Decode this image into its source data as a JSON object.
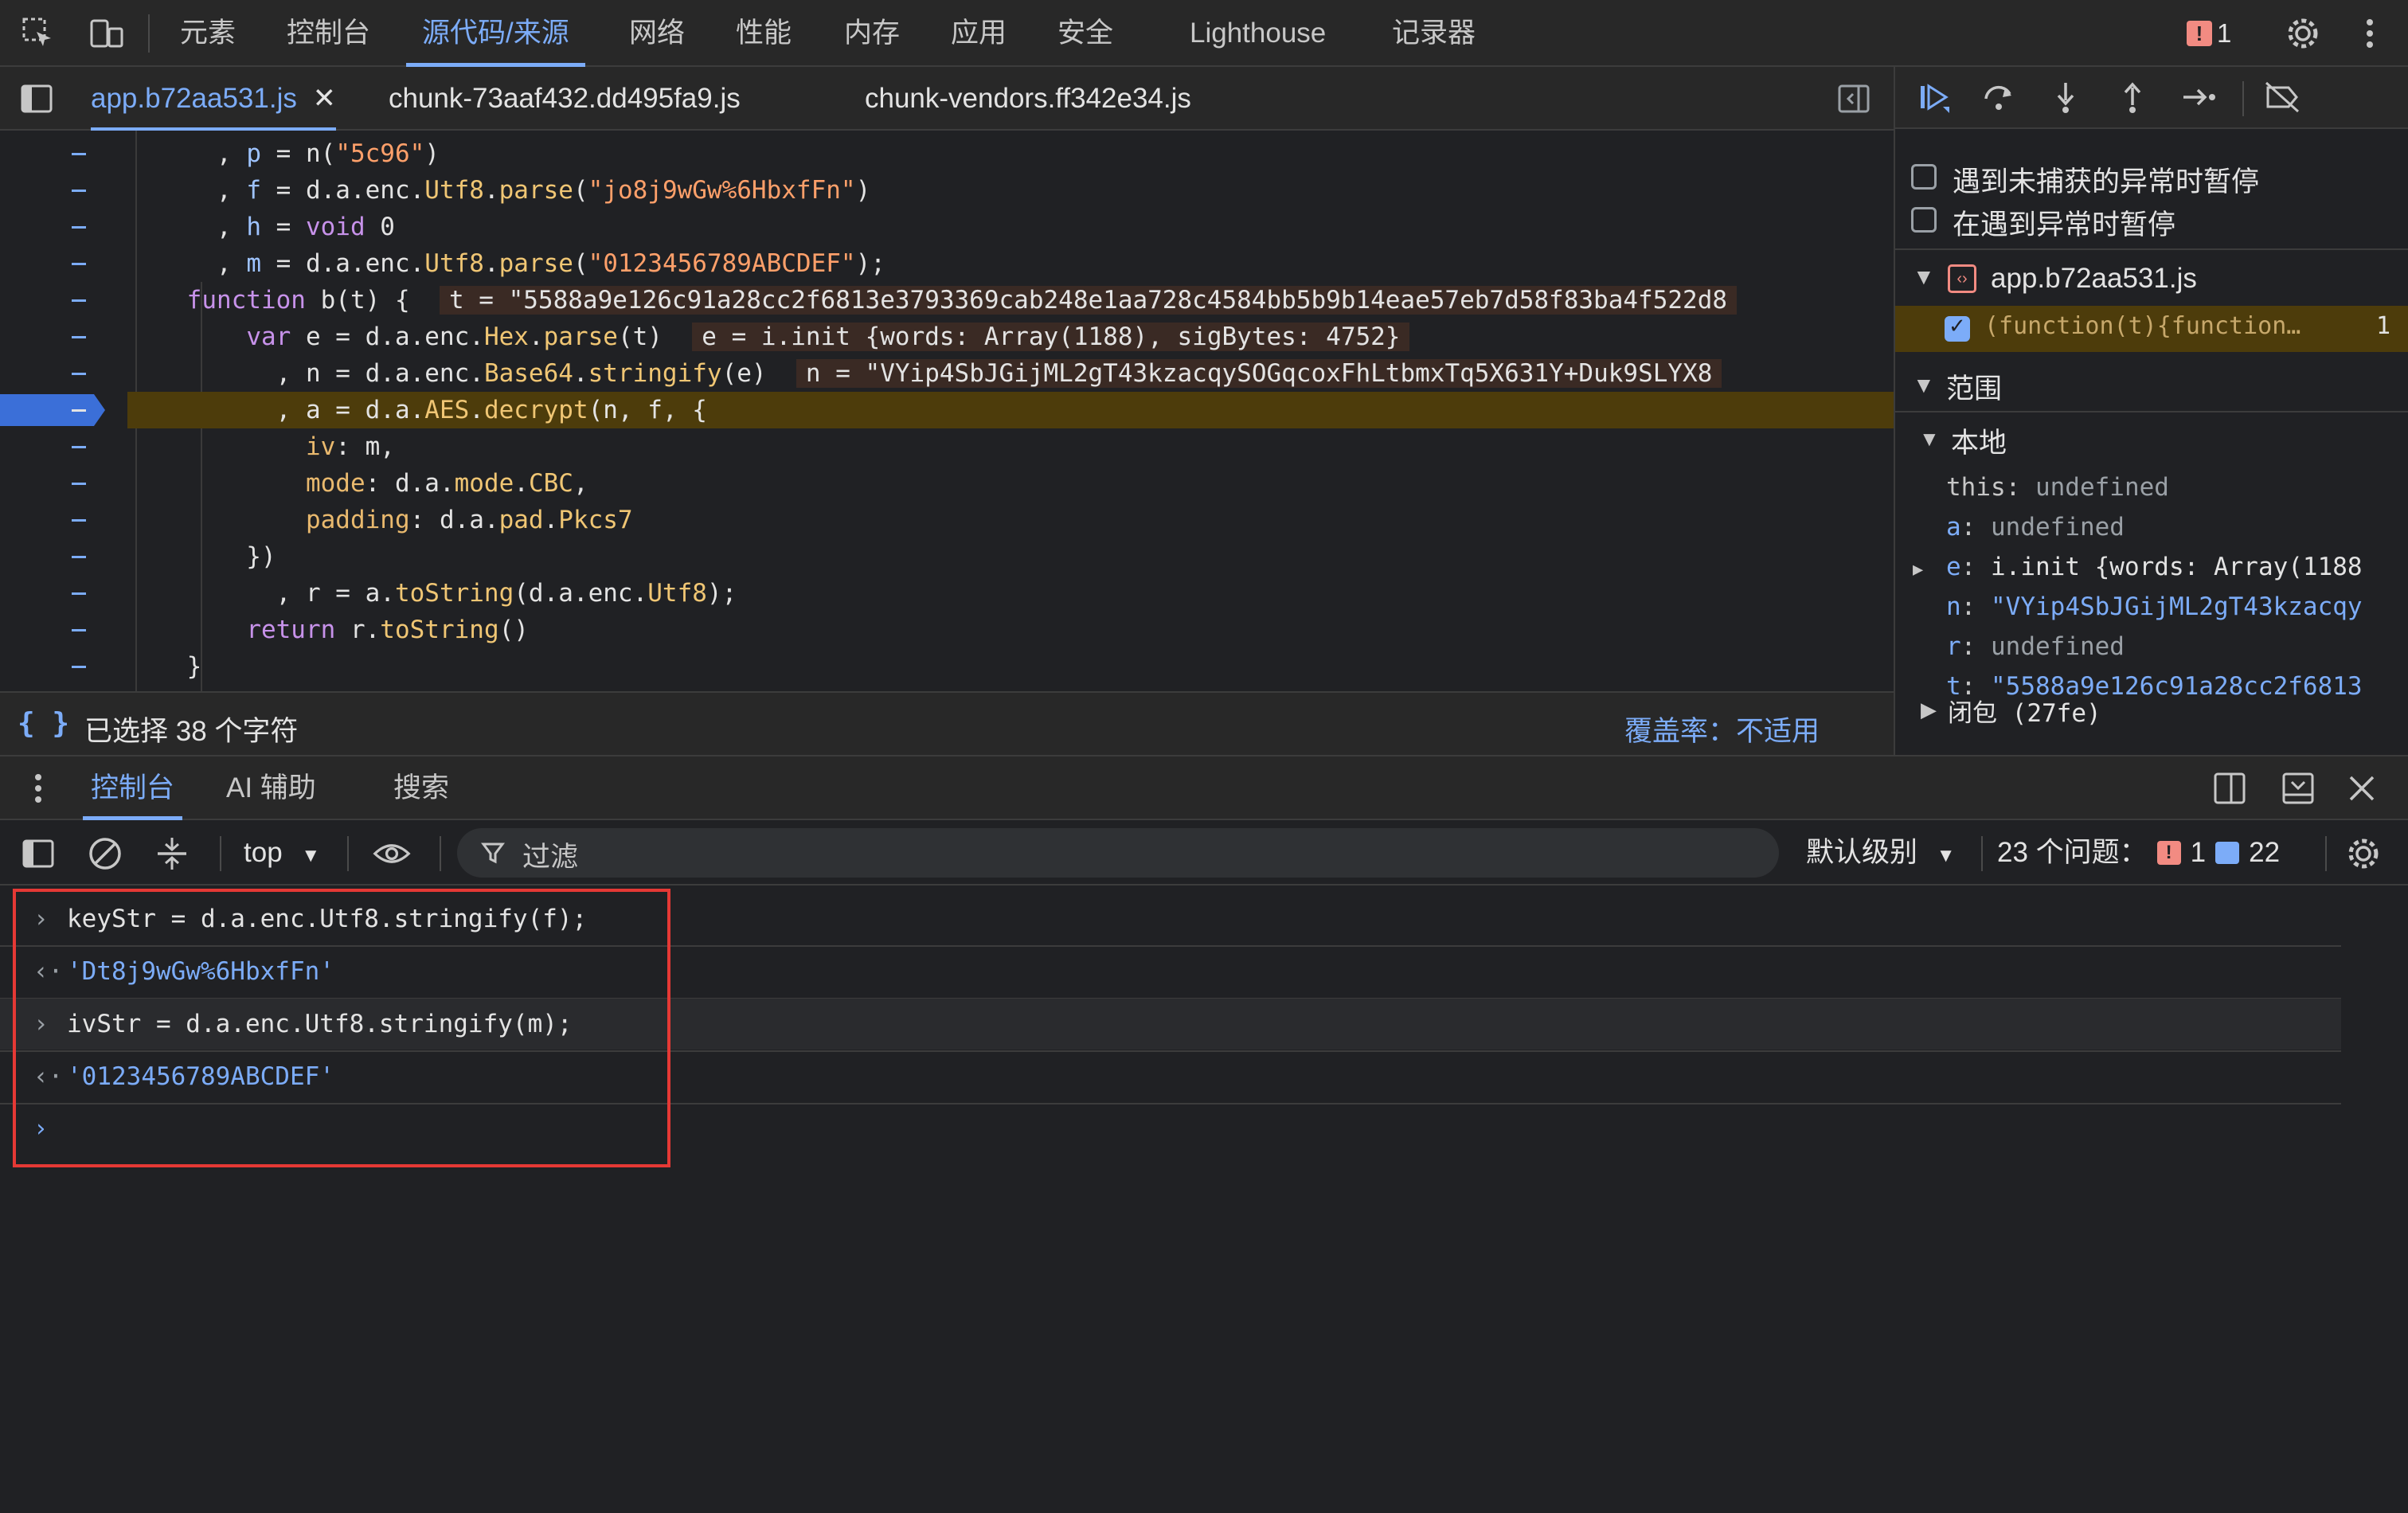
{
  "top_tabs": [
    "元素",
    "控制台",
    "源代码/来源",
    "网络",
    "性能",
    "内存",
    "应用",
    "安全",
    "Lighthouse",
    "记录器"
  ],
  "active_top_tab": "源代码/来源",
  "issues_badge": "1",
  "file_tabs": [
    {
      "label": "app.b72aa531.js",
      "active": true
    },
    {
      "label": "chunk-73aaf432.dd495fa9.js",
      "active": false
    },
    {
      "label": "chunk-vendors.ff342e34.js",
      "active": false
    }
  ],
  "code": {
    "lines": [
      [
        {
          "t": "      , ",
          "c": ""
        },
        {
          "t": "p",
          "c": "var"
        },
        {
          "t": " = n(",
          "c": ""
        },
        {
          "t": "\"5c96\"",
          "c": "str"
        },
        {
          "t": ")",
          "c": ""
        }
      ],
      [
        {
          "t": "      , ",
          "c": ""
        },
        {
          "t": "f",
          "c": "var"
        },
        {
          "t": " = d.a.enc.",
          "c": ""
        },
        {
          "t": "Utf8",
          "c": "fn"
        },
        {
          "t": ".",
          "c": ""
        },
        {
          "t": "parse",
          "c": "fn"
        },
        {
          "t": "(",
          "c": ""
        },
        {
          "t": "\"jo8j9wGw%6HbxfFn\"",
          "c": "str"
        },
        {
          "t": ")",
          "c": ""
        }
      ],
      [
        {
          "t": "      , ",
          "c": ""
        },
        {
          "t": "h",
          "c": "var"
        },
        {
          "t": " = ",
          "c": ""
        },
        {
          "t": "void",
          "c": "kw"
        },
        {
          "t": " 0",
          "c": ""
        }
      ],
      [
        {
          "t": "      , ",
          "c": ""
        },
        {
          "t": "m",
          "c": "var"
        },
        {
          "t": " = d.a.enc.",
          "c": ""
        },
        {
          "t": "Utf8",
          "c": "fn"
        },
        {
          "t": ".",
          "c": ""
        },
        {
          "t": "parse",
          "c": "fn"
        },
        {
          "t": "(",
          "c": ""
        },
        {
          "t": "\"0123456789ABCDEF\"",
          "c": "str"
        },
        {
          "t": ");",
          "c": ""
        }
      ],
      [
        {
          "t": "    ",
          "c": ""
        },
        {
          "t": "function",
          "c": "kw"
        },
        {
          "t": " b(t) {  ",
          "c": ""
        },
        {
          "t": "t = \"5588a9e126c91a28cc2f6813e3793369cab248e1aa728c4584bb5b9b14eae57eb7d58f83ba4f522d8",
          "c": "inl"
        }
      ],
      [
        {
          "t": "        ",
          "c": ""
        },
        {
          "t": "var",
          "c": "kw"
        },
        {
          "t": " e = d.a.enc.",
          "c": ""
        },
        {
          "t": "Hex",
          "c": "fn"
        },
        {
          "t": ".",
          "c": ""
        },
        {
          "t": "parse",
          "c": "fn"
        },
        {
          "t": "(t)  ",
          "c": ""
        },
        {
          "t": "e = i.init {words: Array(1188), sigBytes: 4752}",
          "c": "inl"
        }
      ],
      [
        {
          "t": "          , n = d.a.enc.",
          "c": ""
        },
        {
          "t": "Base64",
          "c": "fn"
        },
        {
          "t": ".",
          "c": ""
        },
        {
          "t": "stringify",
          "c": "fn"
        },
        {
          "t": "(e)  ",
          "c": ""
        },
        {
          "t": "n = \"VYip4SbJGijML2gT43kzacqySOGqcoxFhLtbmxTq5X631Y+Duk9SLYX8",
          "c": "inl"
        }
      ],
      [
        {
          "t": "          , a = ",
          "c": ""
        },
        {
          "t": "d",
          "c": ""
        },
        {
          "t": ".a.",
          "c": ""
        },
        {
          "t": "AES",
          "c": "fn"
        },
        {
          "t": ".",
          "c": ""
        },
        {
          "t": "decrypt",
          "c": "fn"
        },
        {
          "t": "(n, f, {",
          "c": ""
        }
      ],
      [
        {
          "t": "            ",
          "c": ""
        },
        {
          "t": "iv",
          "c": "key"
        },
        {
          "t": ": m,",
          "c": ""
        }
      ],
      [
        {
          "t": "            ",
          "c": ""
        },
        {
          "t": "mode",
          "c": "key"
        },
        {
          "t": ": d.a.",
          "c": ""
        },
        {
          "t": "mode",
          "c": "fn"
        },
        {
          "t": ".",
          "c": ""
        },
        {
          "t": "CBC",
          "c": "fn"
        },
        {
          "t": ",",
          "c": ""
        }
      ],
      [
        {
          "t": "            ",
          "c": ""
        },
        {
          "t": "padding",
          "c": "key"
        },
        {
          "t": ": d.a.",
          "c": ""
        },
        {
          "t": "pad",
          "c": "fn"
        },
        {
          "t": ".",
          "c": ""
        },
        {
          "t": "Pkcs7",
          "c": "fn"
        }
      ],
      [
        {
          "t": "        })",
          "c": ""
        }
      ],
      [
        {
          "t": "          , r = a.",
          "c": ""
        },
        {
          "t": "toString",
          "c": "fn"
        },
        {
          "t": "(d.a.enc.",
          "c": ""
        },
        {
          "t": "Utf8",
          "c": "fn"
        },
        {
          "t": ");",
          "c": ""
        }
      ],
      [
        {
          "t": "        ",
          "c": ""
        },
        {
          "t": "return",
          "c": "kw"
        },
        {
          "t": " r.",
          "c": ""
        },
        {
          "t": "toString",
          "c": "fn"
        },
        {
          "t": "()",
          "c": ""
        }
      ],
      [
        {
          "t": "    }",
          "c": ""
        }
      ]
    ],
    "paused_line_index": 7
  },
  "status": {
    "selection": "已选择 38 个字符",
    "coverage": "覆盖率：不适用"
  },
  "right_panel": {
    "pause_uncaught": "遇到未捕获的异常时暂停",
    "pause_caught": "在遇到异常时暂停",
    "breakpoint_file": "app.b72aa531.js",
    "breakpoint_code": "(function(t){function…",
    "breakpoint_line": "1",
    "scope_title": "范围",
    "local_title": "本地",
    "scope_vars": [
      {
        "name": "this",
        "value": "undefined",
        "type": "undef",
        "expand": false
      },
      {
        "name": "a",
        "value": "undefined",
        "type": "undef",
        "expand": false
      },
      {
        "name": "e",
        "value": "i.init {words: Array(1188",
        "type": "obj",
        "expand": true
      },
      {
        "name": "n",
        "value": "\"VYip4SbJGijML2gT43kzacqy",
        "type": "str",
        "expand": false
      },
      {
        "name": "r",
        "value": "undefined",
        "type": "undef",
        "expand": false
      },
      {
        "name": "t",
        "value": "\"5588a9e126c91a28cc2f6813",
        "type": "str",
        "expand": false
      }
    ],
    "closure": "闭包 (27fe)"
  },
  "drawer_tabs": [
    "控制台",
    "AI 辅助",
    "搜索"
  ],
  "console_toolbar": {
    "context": "top",
    "filter_placeholder": "过滤",
    "level": "默认级别",
    "issues_label": "23 个问题：",
    "issues_warn": "1",
    "issues_info": "22"
  },
  "console_lines": [
    {
      "kind": "input",
      "text": "keyStr = d.a.enc.Utf8.stringify(f);"
    },
    {
      "kind": "output",
      "text": "'Dt8j9wGw%6HbxfFn'"
    },
    {
      "kind": "input",
      "text": "ivStr = d.a.enc.Utf8.stringify(m);"
    },
    {
      "kind": "output",
      "text": "'0123456789ABCDEF'"
    }
  ],
  "colors": {
    "accent": "#7cacf8",
    "highlight_box": "#e53935",
    "paused_line": "#4d3c0b",
    "badge": "#f28b82"
  }
}
